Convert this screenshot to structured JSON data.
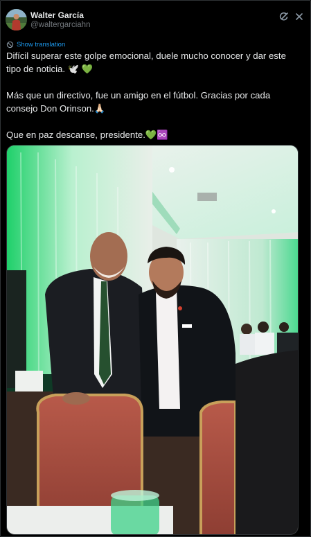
{
  "post": {
    "author": {
      "display_name": "Walter García",
      "handle": "@waltergarciahn"
    },
    "show_translation_label": "Show translation",
    "text_lines": [
      "Difícil superar este golpe emocional, duele mucho conocer y dar este",
      "tipo de noticia. 🕊️ 💚",
      "",
      "Más que un directivo, fue un amigo en el fútbol. Gracias por cada",
      "consejo Don Orinson.🙏🏻",
      "",
      "Que en paz descanse, presidente.💚♾️"
    ]
  },
  "icons": {
    "grok": "grok-icon",
    "more": "more-icon",
    "translate": "translate-icon"
  },
  "colors": {
    "background": "#000000",
    "text": "#e7e9ea",
    "secondary": "#71767b",
    "link": "#1d9bf0"
  }
}
